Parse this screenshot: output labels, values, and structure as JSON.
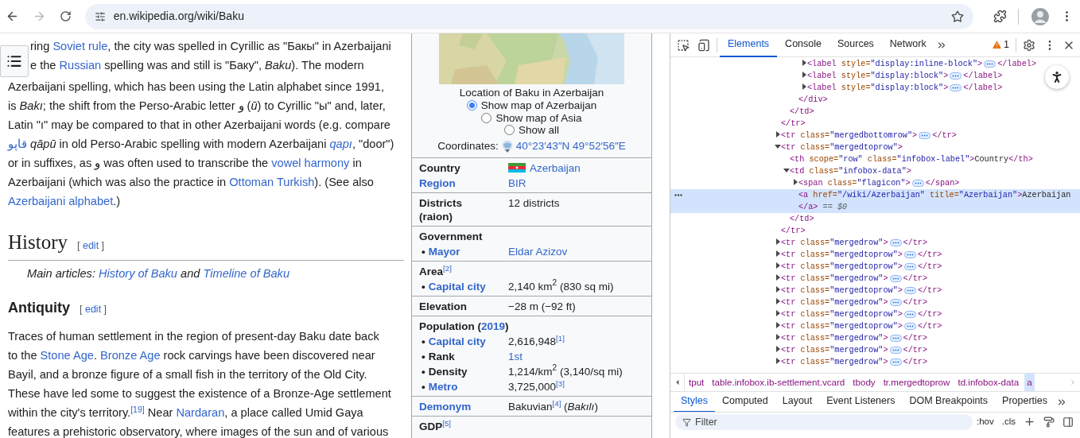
{
  "browser": {
    "url": "en.wikipedia.org/wiki/Baku",
    "forward_disabled": true
  },
  "article": {
    "intro_beside_menu": [
      [
        {
          "kind": "text",
          "text": "ring "
        },
        {
          "kind": "link",
          "text": "Soviet rule"
        },
        {
          "kind": "text",
          "text": ", the city was spelled in Cyrillic as \"Бакы\" in Azerbaijani"
        }
      ],
      [
        {
          "kind": "text",
          "text": "e the "
        },
        {
          "kind": "link",
          "text": "Russian"
        },
        {
          "kind": "text",
          "text": " spelling was and still is \"Баку\", *Baku*). The modern"
        }
      ]
    ],
    "intro": [
      [
        {
          "kind": "text",
          "text": "Azerbaijani spelling, which has been using the Latin alphabet since 1991,"
        }
      ],
      [
        {
          "kind": "text",
          "text": "is *Bakı*; the shift from the Perso-Arabic letter و (*ū*) to Cyrillic \"ы\" and, later,"
        }
      ],
      [
        {
          "kind": "text",
          "text": "Latin \"ı\" may be compared to that in other Azerbaijani words (e.g. compare"
        }
      ],
      [
        {
          "kind": "link",
          "text": "قاپو"
        },
        {
          "kind": "text",
          "text": " *qāpū* in old Perso-Arabic spelling with modern Azerbaijani "
        },
        {
          "kind": "italic_link",
          "text": "qapı"
        },
        {
          "kind": "text",
          "text": ", \"door\")"
        }
      ],
      [
        {
          "kind": "text",
          "text": "or in suffixes, as و was often used to transcribe the "
        },
        {
          "kind": "link",
          "text": "vowel harmony"
        },
        {
          "kind": "text",
          "text": " in"
        }
      ],
      [
        {
          "kind": "text",
          "text": "Azerbaijani (which was also the practice in "
        },
        {
          "kind": "link",
          "text": "Ottoman Turkish"
        },
        {
          "kind": "text",
          "text": "). (See also"
        }
      ],
      [
        {
          "kind": "link",
          "text": "Azerbaijani alphabet"
        },
        {
          "kind": "text",
          "text": ".)"
        }
      ]
    ],
    "history": {
      "title": "History",
      "edit": [
        "[",
        "edit",
        "]"
      ],
      "hatnote": [
        {
          "kind": "text",
          "text": "Main articles: "
        },
        {
          "kind": "link",
          "text": "History of Baku"
        },
        {
          "kind": "text",
          "text": " and "
        },
        {
          "kind": "link",
          "text": "Timeline of Baku"
        }
      ]
    },
    "antiquity": {
      "title": "Antiquity",
      "edit": [
        "[",
        "edit",
        "]"
      ],
      "lines": [
        [
          {
            "kind": "text",
            "text": "Traces of human settlement in the region of present-day Baku date back"
          }
        ],
        [
          {
            "kind": "text",
            "text": "to the "
          },
          {
            "kind": "link",
            "text": "Stone Age"
          },
          {
            "kind": "text",
            "text": ". "
          },
          {
            "kind": "link",
            "text": "Bronze Age"
          },
          {
            "kind": "text",
            "text": " rock carvings have been discovered near"
          }
        ],
        [
          {
            "kind": "text",
            "text": "Bayil, and a bronze figure of a small fish in the territory of the Old City."
          }
        ],
        [
          {
            "kind": "text",
            "text": "These have led some to suggest the existence of a Bronze-Age settlement"
          }
        ],
        [
          {
            "kind": "text",
            "text": "within the city's territory."
          },
          {
            "kind": "ref",
            "text": "[19]"
          },
          {
            "kind": "text",
            "text": " Near "
          },
          {
            "kind": "link",
            "text": "Nardaran"
          },
          {
            "kind": "text",
            "text": ", a place called Umid Gaya"
          }
        ],
        [
          {
            "kind": "text",
            "text": "features a prehistoric observatory, where images of the sun and of various"
          }
        ]
      ]
    }
  },
  "infobox": {
    "map_caption": "Location of Baku in Azerbaijan",
    "radios": [
      {
        "label": "Show map of Azerbaijan",
        "selected": true
      },
      {
        "label": "Show map of Asia",
        "selected": false
      },
      {
        "label": "Show all",
        "selected": false
      }
    ],
    "coordinates": {
      "label": "Coordinates:",
      "value": "40°23′43″N 49°52′56″E"
    },
    "sections": [
      {
        "rows": [
          {
            "label": [
              {
                "kind": "bold",
                "text": "Country"
              }
            ],
            "value": [
              {
                "kind": "flag"
              },
              {
                "kind": "link",
                "text": "Azerbaijan"
              }
            ]
          },
          {
            "label": [
              {
                "kind": "bold_link",
                "text": "Region"
              }
            ],
            "value": [
              {
                "kind": "link",
                "text": "BIR"
              }
            ]
          }
        ]
      },
      {
        "rows": [
          {
            "label": [
              {
                "kind": "bold",
                "text": "Districts (raion)"
              }
            ],
            "value": [
              {
                "kind": "text",
                "text": "12 districts"
              }
            ]
          }
        ]
      },
      {
        "rows": [
          {
            "label": [
              {
                "kind": "bold",
                "text": "Government"
              }
            ]
          },
          {
            "bullet": "•",
            "label": [
              {
                "kind": "bold_link",
                "text": "Mayor"
              }
            ],
            "value": [
              {
                "kind": "link",
                "text": "Eldar Azizov"
              }
            ]
          }
        ]
      },
      {
        "rows": [
          {
            "label": [
              {
                "kind": "bold",
                "text": "Area"
              },
              {
                "kind": "ref",
                "text": "[2]"
              }
            ]
          },
          {
            "bullet": "•",
            "label": [
              {
                "kind": "bold_link",
                "text": "Capital city"
              }
            ],
            "value": [
              {
                "kind": "text",
                "text": "2,140 km$^{2}$ (830 sq mi)"
              }
            ]
          }
        ]
      },
      {
        "rows": [
          {
            "label": [
              {
                "kind": "bold",
                "text": "Elevation"
              }
            ],
            "value": [
              {
                "kind": "text",
                "text": "−28 m (−92 ft)"
              }
            ]
          }
        ]
      },
      {
        "rows": [
          {
            "label": [
              {
                "kind": "bold",
                "text": "Population"
              },
              {
                "kind": "text",
                "text": " ("
              },
              {
                "kind": "link",
                "text": "2019"
              },
              {
                "kind": "text",
                "text": ")"
              }
            ]
          },
          {
            "bullet": "•",
            "label": [
              {
                "kind": "bold_link",
                "text": "Capital city"
              }
            ],
            "value": [
              {
                "kind": "text",
                "text": "2,616,948"
              },
              {
                "kind": "ref",
                "text": "[1]"
              }
            ]
          },
          {
            "bullet": "•",
            "label": [
              {
                "kind": "bold",
                "text": "Rank"
              }
            ],
            "value": [
              {
                "kind": "link",
                "text": "1st"
              }
            ]
          },
          {
            "bullet": "•",
            "label": [
              {
                "kind": "bold",
                "text": "Density"
              }
            ],
            "value": [
              {
                "kind": "text",
                "text": "1,214/km$^{2}$ (3,140/sq mi)"
              }
            ]
          },
          {
            "bullet": "•",
            "label": [
              {
                "kind": "bold_link",
                "text": "Metro"
              }
            ],
            "value": [
              {
                "kind": "text",
                "text": "3,725,000"
              },
              {
                "kind": "ref",
                "text": "[3]"
              }
            ]
          }
        ]
      },
      {
        "rows": [
          {
            "label": [
              {
                "kind": "bold_link",
                "text": "Demonym"
              }
            ],
            "value": [
              {
                "kind": "text",
                "text": "Bakuvian"
              },
              {
                "kind": "ref",
                "text": "[4]"
              },
              {
                "kind": "text",
                "text": " (*Bakılı*)"
              }
            ]
          }
        ]
      },
      {
        "rows": [
          {
            "label": [
              {
                "kind": "bold",
                "text": "GDP"
              },
              {
                "kind": "ref",
                "text": "[5]"
              }
            ]
          }
        ]
      }
    ]
  },
  "devtools": {
    "tabs": [
      {
        "label": "Elements",
        "selected": true
      },
      {
        "label": "Console",
        "selected": false
      },
      {
        "label": "Sources",
        "selected": false
      },
      {
        "label": "Network",
        "selected": false
      }
    ],
    "warnings": "1",
    "dom_tree": [
      {
        "kind": "continued",
        "close": "</tr>",
        "selected": false,
        "children": [
          {
            "kind": "continued",
            "close": "</td>",
            "selected": false,
            "children": [
              {
                "kind": "continued",
                "close": "</div>",
                "selected": false,
                "children": [
                  {
                    "kind": "element",
                    "open": "<label style=\"display:inline-block\">",
                    "close": "</label>",
                    "expanded": false,
                    "selected": false
                  },
                  {
                    "kind": "element",
                    "open": "<label style=\"display:block\">",
                    "close": "</label>",
                    "expanded": false,
                    "selected": false
                  },
                  {
                    "kind": "element",
                    "open": "<label style=\"display:block\">",
                    "close": "</label>",
                    "expanded": false,
                    "selected": false
                  }
                ]
              }
            ]
          }
        ]
      },
      {
        "kind": "element",
        "open": "<tr class=\"mergedbottomrow\">",
        "close": "</tr>",
        "expanded": false,
        "selected": false
      },
      {
        "kind": "element",
        "open": "<tr class=\"mergedtoprow\">",
        "close": "</tr>",
        "expanded": true,
        "selected": false,
        "children": [
          {
            "kind": "leaf",
            "open": "<th scope=\"row\" class=\"infobox-label\">",
            "text": "Country",
            "close": "</th>",
            "selected": false
          },
          {
            "kind": "element",
            "open": "<td class=\"infobox-data\">",
            "close": "</td>",
            "expanded": true,
            "selected": false,
            "children": [
              {
                "kind": "element",
                "open": "<span class=\"flagicon\">",
                "close": "</span>",
                "expanded": false,
                "selected": false
              },
              {
                "kind": "leaf",
                "open": "<a href=\"/wiki/Azerbaijan\" title=\"Azerbaijan\">",
                "text": "Azerbaijan",
                "close": "</a>",
                "selected": true,
                "marker": "== $0"
              }
            ]
          }
        ]
      },
      {
        "kind": "element",
        "open": "<tr class=\"mergedrow\">",
        "close": "</tr>",
        "expanded": false,
        "selected": false
      },
      {
        "kind": "element",
        "open": "<tr class=\"mergedtoprow\">",
        "close": "</tr>",
        "expanded": false,
        "selected": false
      },
      {
        "kind": "element",
        "open": "<tr class=\"mergedtoprow\">",
        "close": "</tr>",
        "expanded": false,
        "selected": false
      },
      {
        "kind": "element",
        "open": "<tr class=\"mergedrow\">",
        "close": "</tr>",
        "expanded": false,
        "selected": false
      },
      {
        "kind": "element",
        "open": "<tr class=\"mergedtoprow\">",
        "close": "</tr>",
        "expanded": false,
        "selected": false
      },
      {
        "kind": "element",
        "open": "<tr class=\"mergedrow\">",
        "close": "</tr>",
        "expanded": false,
        "selected": false
      },
      {
        "kind": "element",
        "open": "<tr class=\"mergedtoprow\">",
        "close": "</tr>",
        "expanded": false,
        "selected": false
      },
      {
        "kind": "element",
        "open": "<tr class=\"mergedtoprow\">",
        "close": "</tr>",
        "expanded": false,
        "selected": false
      },
      {
        "kind": "element",
        "open": "<tr class=\"mergedrow\">",
        "close": "</tr>",
        "expanded": false,
        "selected": false
      },
      {
        "kind": "element",
        "open": "<tr class=\"mergedrow\">",
        "close": "</tr>",
        "expanded": false,
        "selected": false
      },
      {
        "kind": "element",
        "open": "<tr class=\"mergedrow\">",
        "close": "</tr>",
        "expanded": false,
        "selected": false
      }
    ],
    "breadcrumbs": [
      {
        "label": "tput",
        "selected": false
      },
      {
        "label": "table.infobox.ib-settlement.vcard",
        "selected": false
      },
      {
        "label": "tbody",
        "selected": false
      },
      {
        "label": "tr.mergedtoprow",
        "selected": false
      },
      {
        "label": "td.infobox-data",
        "selected": false
      },
      {
        "label": "a",
        "selected": true
      }
    ],
    "style_tabs": [
      {
        "label": "Styles",
        "selected": true
      },
      {
        "label": "Computed",
        "selected": false
      },
      {
        "label": "Layout",
        "selected": false
      },
      {
        "label": "Event Listeners",
        "selected": false
      },
      {
        "label": "DOM Breakpoints",
        "selected": false
      },
      {
        "label": "Properties",
        "selected": false
      }
    ],
    "filter": {
      "placeholder": "Filter"
    },
    "style_buttons": [
      ":hov",
      ".cls"
    ]
  }
}
